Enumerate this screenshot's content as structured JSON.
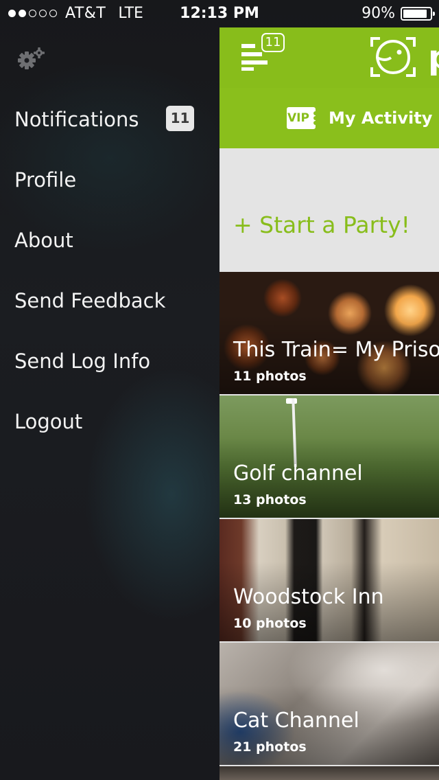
{
  "status_bar": {
    "signal_dots": [
      "full",
      "full",
      "empty",
      "empty",
      "empty"
    ],
    "carrier": "AT&T",
    "network": "LTE",
    "time": "12:13 PM",
    "battery_percent": "90%",
    "battery_level": 0.9
  },
  "menu": {
    "settings_icon": "gear-icon",
    "items": [
      {
        "label": "Notifications",
        "badge": "11"
      },
      {
        "label": "Profile"
      },
      {
        "label": "About"
      },
      {
        "label": "Send Feedback"
      },
      {
        "label": "Send Log Info"
      },
      {
        "label": "Logout"
      }
    ]
  },
  "header": {
    "menu_icon": "hamburger-icon",
    "notification_count": "11",
    "logo_icon": "bird-logo-icon",
    "brand_partial": "p",
    "brand_color": "#88bd1b",
    "tab_icon": "vip-ticket-icon",
    "vip_text": "VIP",
    "tab_label": "My Activity"
  },
  "main": {
    "start_party": "+ Start a Party!",
    "channels": [
      {
        "title": "This Train= My Prison",
        "count": "11 photos"
      },
      {
        "title": "Golf channel",
        "count": "13 photos"
      },
      {
        "title": "Woodstock Inn",
        "count": "10 photos"
      },
      {
        "title": "Cat Channel",
        "count": "21 photos"
      }
    ]
  }
}
